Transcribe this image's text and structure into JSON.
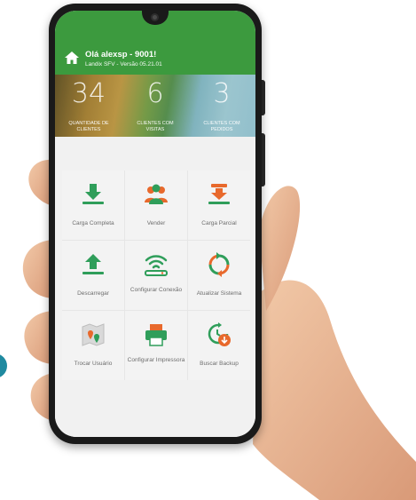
{
  "header": {
    "greeting": "Olá alexsp - 9001!",
    "version": "Landix SFV - Versão 05.21.01"
  },
  "stats": [
    {
      "value": "34",
      "label": "QUANTIDADE DE CLIENTES"
    },
    {
      "value": "6",
      "label": "CLIENTES COM VISITAS"
    },
    {
      "value": "3",
      "label": "CLIENTES COM PEDIDOS"
    }
  ],
  "menu": [
    {
      "label": "Carga Completa",
      "icon": "download-icon"
    },
    {
      "label": "Vender",
      "icon": "users-icon"
    },
    {
      "label": "Carga Parcial",
      "icon": "partial-load-icon"
    },
    {
      "label": "Descarregar",
      "icon": "upload-icon"
    },
    {
      "label": "Configurar Conexão",
      "icon": "wifi-icon"
    },
    {
      "label": "Atualizar Sistema",
      "icon": "refresh-icon"
    },
    {
      "label": "Trocar Usuário",
      "icon": "map-pins-icon"
    },
    {
      "label": "Configurar Impressora",
      "icon": "printer-icon"
    },
    {
      "label": "Buscar Backup",
      "icon": "backup-icon"
    }
  ],
  "colors": {
    "header_green": "#3c9a3e",
    "icon_green": "#2f9e5a",
    "icon_orange": "#e8692c",
    "tile_bg": "#f3f3f3"
  }
}
